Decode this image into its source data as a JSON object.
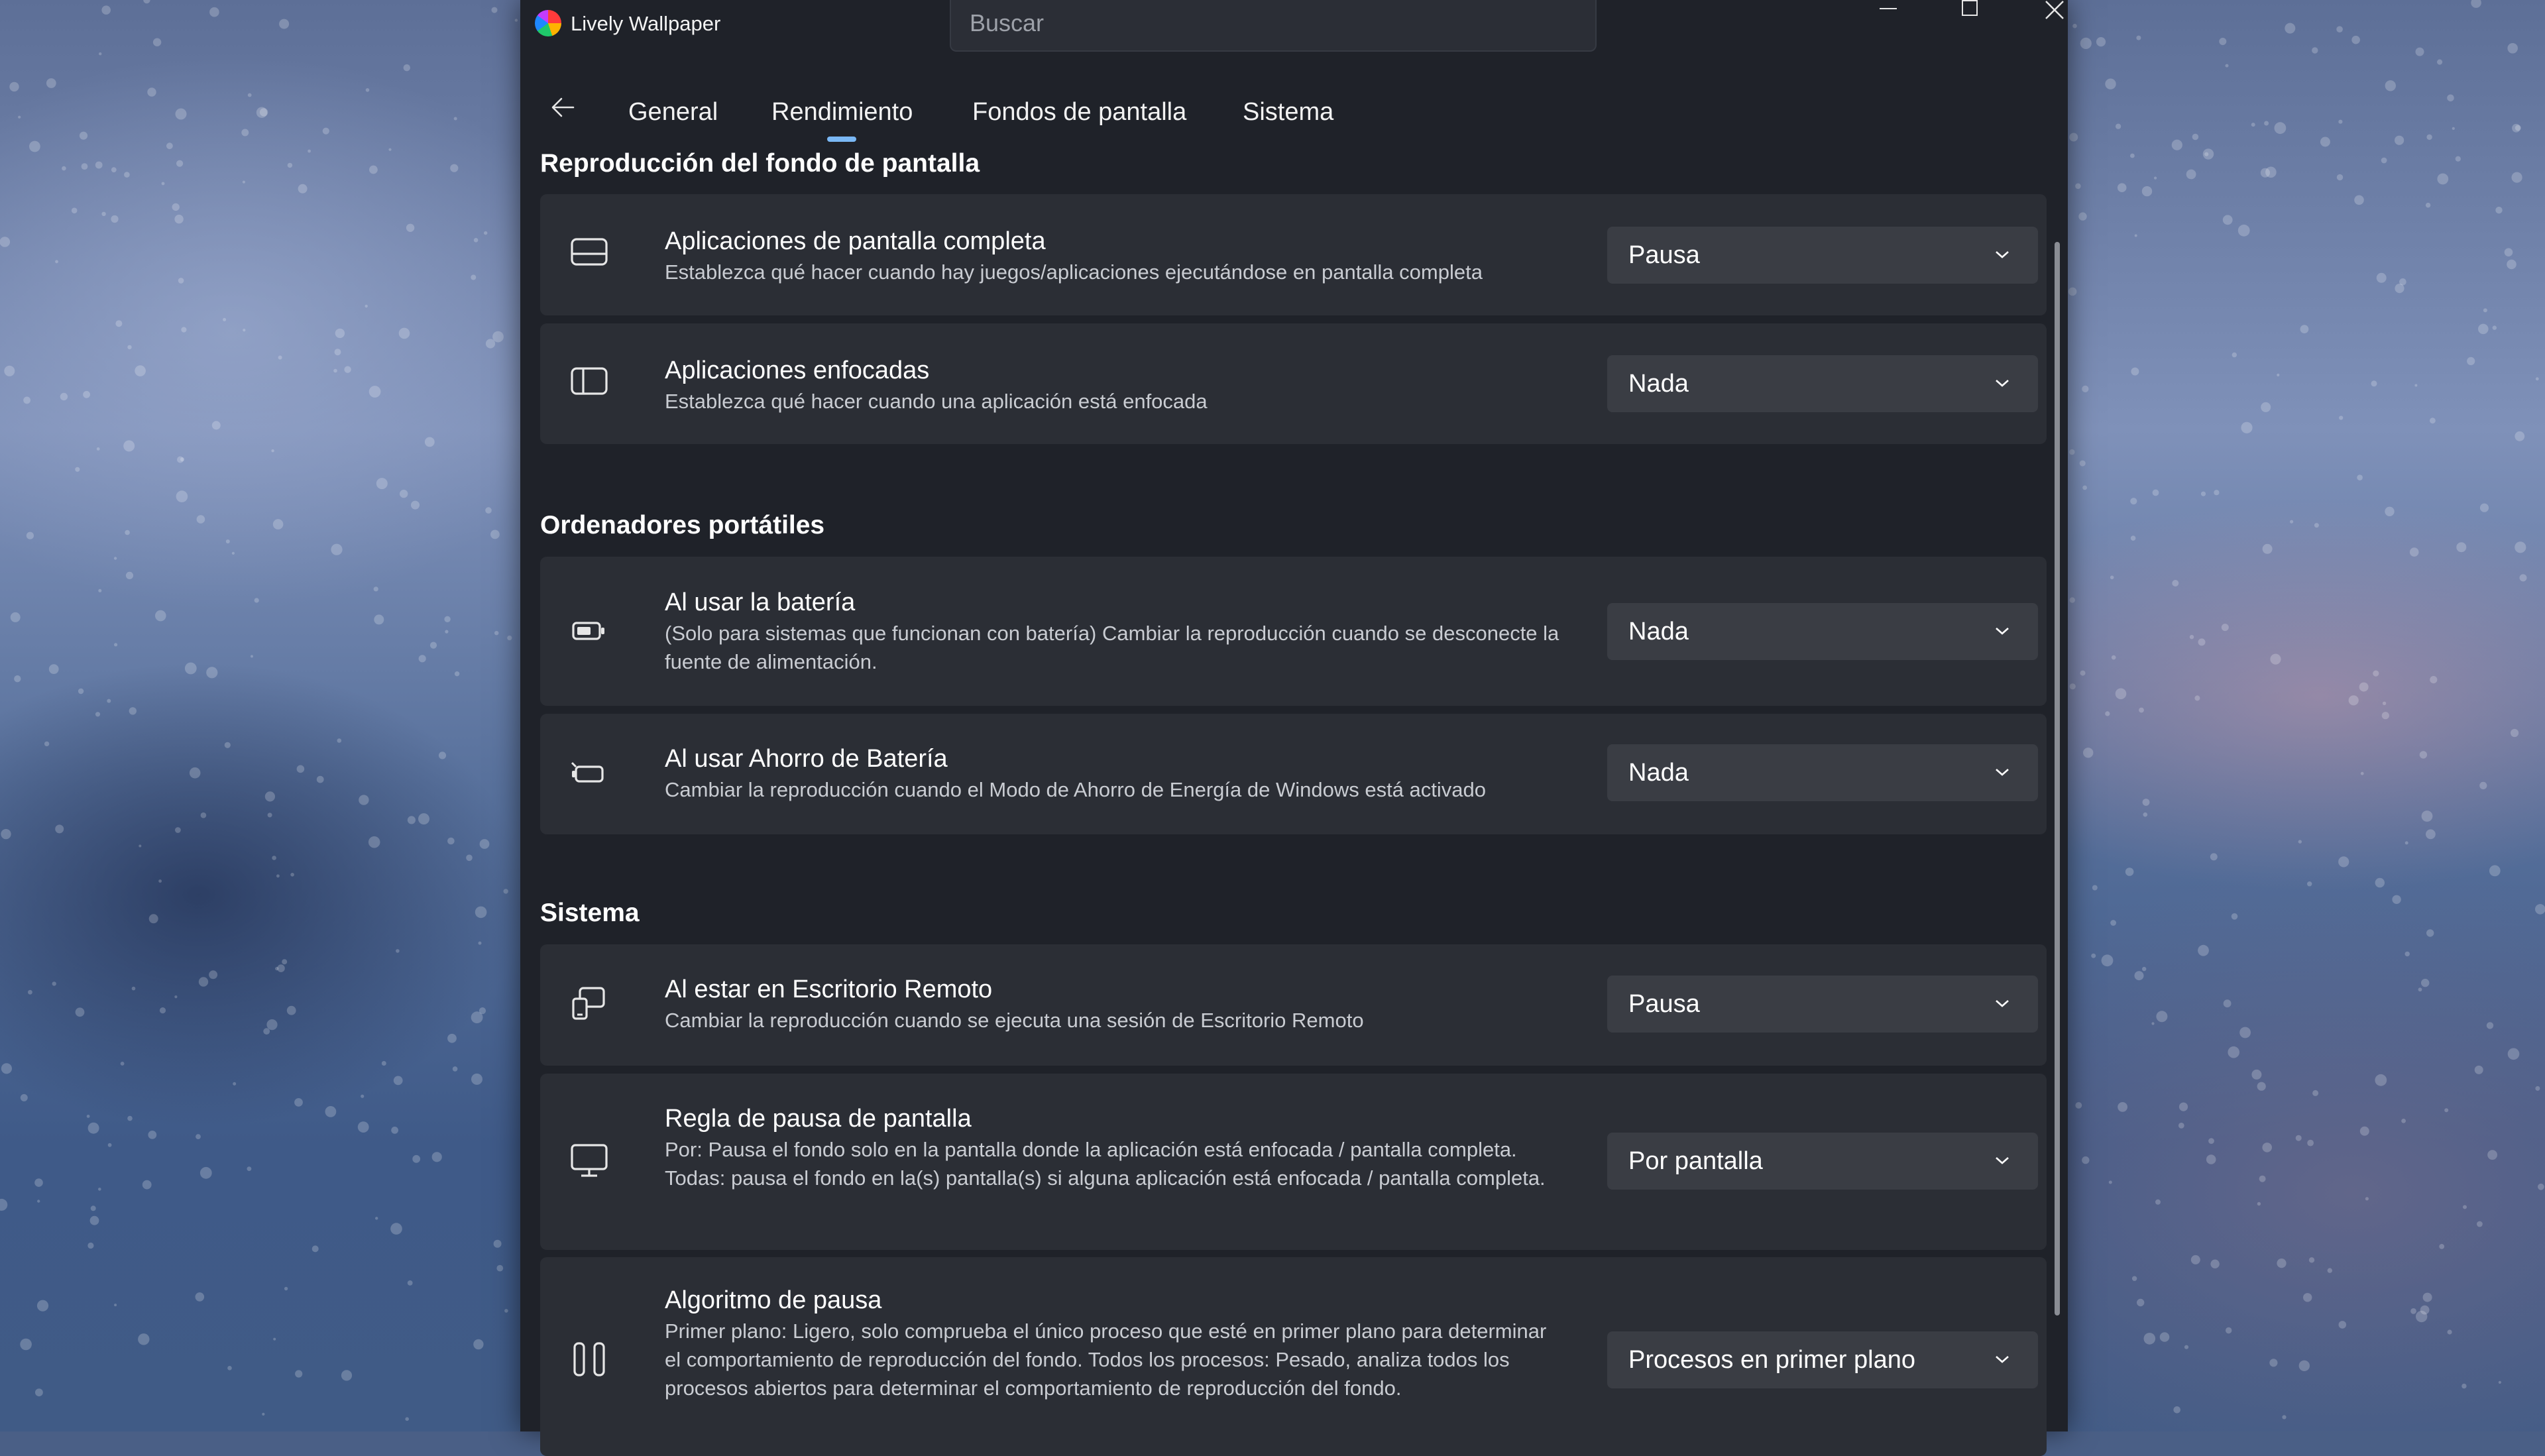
{
  "window": {
    "title": "Lively Wallpaper",
    "search_placeholder": "Buscar"
  },
  "tabs": [
    {
      "label": "General"
    },
    {
      "label": "Rendimiento",
      "selected": true
    },
    {
      "label": "Fondos de pantalla"
    },
    {
      "label": "Sistema"
    }
  ],
  "sections": [
    {
      "title": "Reproducción del fondo de pantalla",
      "items": [
        {
          "title": "Aplicaciones de pantalla completa",
          "description": "Establezca qué hacer cuando hay juegos/aplicaciones ejecutándose en pantalla completa",
          "value": "Pausa",
          "icon": "fullscreen-app-icon"
        },
        {
          "title": "Aplicaciones enfocadas",
          "description": "Establezca qué hacer cuando una aplicación está enfocada",
          "value": "Nada",
          "icon": "focused-app-icon"
        }
      ]
    },
    {
      "title": "Ordenadores portátiles",
      "items": [
        {
          "title": "Al usar la batería",
          "description": "(Solo para sistemas que funcionan con batería) Cambiar la reproducción cuando se desconecte la fuente de alimentación.",
          "value": "Nada",
          "icon": "battery-icon"
        },
        {
          "title": "Al usar Ahorro de Batería",
          "description": "Cambiar la reproducción cuando el Modo de Ahorro de Energía de Windows está activado",
          "value": "Nada",
          "icon": "battery-saver-icon"
        }
      ]
    },
    {
      "title": "Sistema",
      "items": [
        {
          "title": "Al estar en Escritorio Remoto",
          "description": "Cambiar la reproducción cuando se ejecuta una sesión de Escritorio Remoto",
          "value": "Pausa",
          "icon": "remote-desktop-icon"
        },
        {
          "title": "Regla de pausa de pantalla",
          "description": "Por: Pausa el fondo solo en la pantalla donde la aplicación está enfocada / pantalla completa. Todas: pausa el fondo en la(s) pantalla(s) si alguna aplicación está enfocada / pantalla completa.",
          "value": "Por pantalla",
          "icon": "monitor-icon"
        },
        {
          "title": "Algoritmo de pausa",
          "description": "Primer plano: Ligero, solo comprueba el único proceso que esté en primer plano para determinar el comportamiento de reproducción del fondo. Todos los procesos: Pesado, analiza todos los procesos abiertos para determinar el comportamiento de reproducción del fondo.",
          "value": "Procesos en primer plano",
          "icon": "pause-icon"
        }
      ]
    }
  ],
  "colors": {
    "window_bg": "#1f2229",
    "card_bg": "#2b2e35",
    "dropdown_bg": "#3a3d44",
    "accent": "#7ab8f5"
  }
}
